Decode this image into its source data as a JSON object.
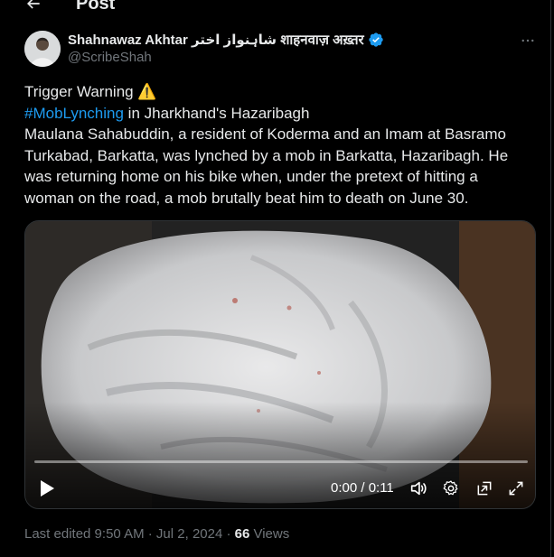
{
  "header": {
    "title": "Post",
    "back_icon": "arrow-left-icon"
  },
  "author": {
    "name": "Shahnawaz Akhtar شاہنواز اختر शाहनवाज़ अख़्तर",
    "handle": "@ScribeShah",
    "verified": true,
    "verified_color": "#1d9bf0"
  },
  "tweet": {
    "line1": "Trigger Warning ⚠️",
    "hashtag": "#MobLynching",
    "line2_rest": " in Jharkhand's Hazaribagh",
    "line3": "Maulana Sahabuddin, a resident of Koderma and an Imam at Basramo",
    "line4": "Turkabad, Barkatta, was lynched by a mob in Barkatta, Hazaribagh. He",
    "line5": "was returning home on his bike when, under the pretext of hitting a",
    "line6": "woman on the road, a mob brutally beat him to death on June 30."
  },
  "video": {
    "time": "0:00 / 0:11",
    "progress": 0
  },
  "meta": {
    "edited": "Last edited 9:50 AM · Jul 2, 2024 · ",
    "views_count": "66",
    "views_label": " Views"
  },
  "colors": {
    "background": "#000000",
    "text": "#e7e9ea",
    "muted": "#71767b",
    "accent": "#1d9bf0"
  }
}
